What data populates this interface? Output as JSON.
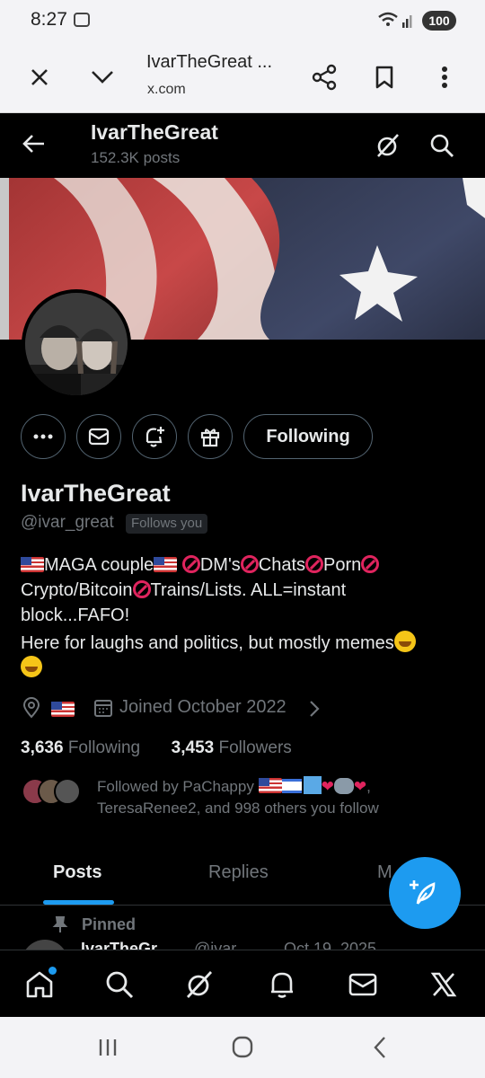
{
  "status_bar": {
    "time": "8:27",
    "battery": "100"
  },
  "browser": {
    "title": "IvarTheGreat ...",
    "domain": "x.com"
  },
  "header": {
    "name": "IvarTheGreat",
    "posts": "152.3K posts"
  },
  "profile": {
    "follow_label": "Following",
    "display_name": "IvarTheGreat",
    "handle": "@ivar_great",
    "follows_you": "Follows you",
    "bio": {
      "line1_a": "MAGA couple",
      "line1_b": "DM's",
      "line1_c": "Chats",
      "line1_d": "Porn",
      "line2_a": "Crypto/Bitcoin",
      "line2_b": "Trains/Lists.  ALL=instant",
      "line3": "block...FAFO!",
      "line4": "Here for laughs and politics, but mostly memes"
    },
    "joined": "Joined October 2022",
    "following_count": "3,636",
    "following_label": "Following",
    "followers_count": "3,453",
    "followers_label": "Followers",
    "followed_by_1": "Followed by PaChappy",
    "followed_by_2": "TeresaRenee2, and 998 others you follow"
  },
  "tabs": [
    "Posts",
    "Replies",
    "M"
  ],
  "pinned": "Pinned",
  "post_peek": {
    "name": "IvarTheGr...",
    "handle": "@ivar...",
    "date": "Oct 19, 2025"
  },
  "colors": {
    "accent": "#1d9bf0",
    "background": "#000000",
    "muted": "#71767b"
  }
}
